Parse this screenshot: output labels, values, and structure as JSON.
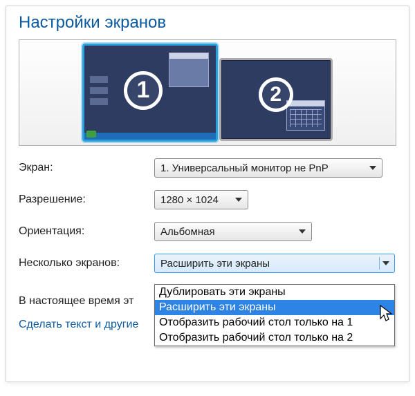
{
  "title": "Настройки экранов",
  "monitors": {
    "one": "1",
    "two": "2"
  },
  "labels": {
    "display": "Экран:",
    "resolution": "Разрешение:",
    "orientation": "Ориентация:",
    "multiple": "Несколько экранов:"
  },
  "values": {
    "display": "1. Универсальный монитор не PnP",
    "resolution": "1280 × 1024",
    "orientation": "Альбомная",
    "multiple": "Расширить эти экраны"
  },
  "multiple_options": [
    "Дублировать эти экраны",
    "Расширить эти экраны",
    "Отобразить рабочий стол только на 1",
    "Отобразить рабочий стол только на 2"
  ],
  "multiple_highlight_index": 1,
  "current_hint": "В настоящее время эт",
  "link": "Сделать текст и другие"
}
